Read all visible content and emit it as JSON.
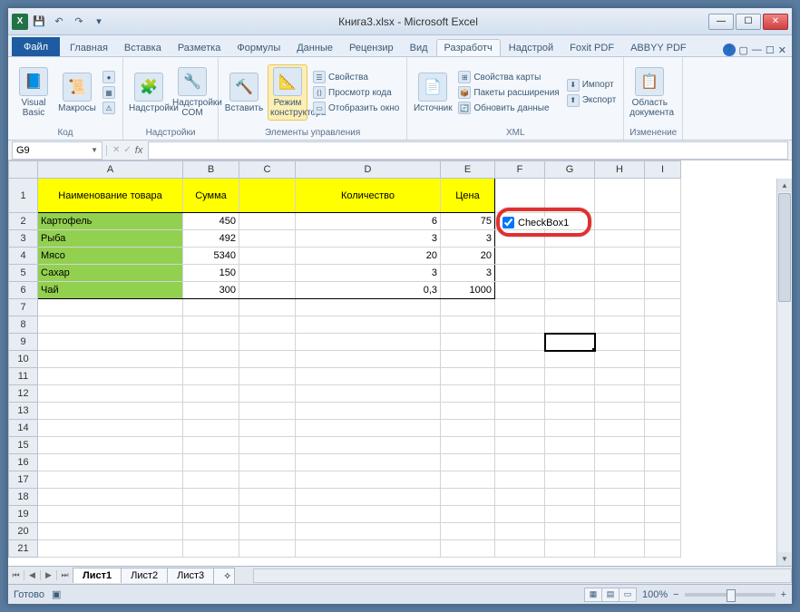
{
  "title": "Книга3.xlsx - Microsoft Excel",
  "qat": {
    "save": "💾",
    "undo": "↶",
    "redo": "↷"
  },
  "tabs": {
    "file": "Файл",
    "list": [
      "Главная",
      "Вставка",
      "Разметка",
      "Формулы",
      "Данные",
      "Рецензир",
      "Вид",
      "Разработч",
      "Надстрой",
      "Foxit PDF",
      "ABBYY PDF"
    ],
    "active": "Разработч"
  },
  "ribbon": {
    "code": {
      "vb": "Visual Basic",
      "macros": "Макросы",
      "label": "Код"
    },
    "addins": {
      "addins": "Надстройки",
      "com": "Надстройки COM",
      "label": "Надстройки"
    },
    "controls": {
      "insert": "Вставить",
      "design": "Режим конструктора",
      "props": "Свойства",
      "viewcode": "Просмотр кода",
      "dialog": "Отобразить окно",
      "label": "Элементы управления"
    },
    "xml": {
      "source": "Источник",
      "mapprops": "Свойства карты",
      "expansion": "Пакеты расширения",
      "refresh": "Обновить данные",
      "import": "Импорт",
      "export": "Экспорт",
      "label": "XML"
    },
    "modify": {
      "panel": "Область документа",
      "label": "Изменение"
    }
  },
  "namebox": "G9",
  "fx": "fx",
  "columns": [
    "A",
    "B",
    "C",
    "D",
    "E",
    "F",
    "G",
    "H",
    "I"
  ],
  "headers": {
    "name": "Наименование товара",
    "sum": "Сумма",
    "qty": "Количество",
    "price": "Цена"
  },
  "rows": [
    {
      "n": "1"
    },
    {
      "n": "2",
      "name": "Картофель",
      "sum": "450",
      "qty": "6",
      "price": "75"
    },
    {
      "n": "3",
      "name": "Рыба",
      "sum": "492",
      "qty": "3",
      "price": "3"
    },
    {
      "n": "4",
      "name": "Мясо",
      "sum": "5340",
      "qty": "20",
      "price": "20"
    },
    {
      "n": "5",
      "name": "Сахар",
      "sum": "150",
      "qty": "3",
      "price": "3"
    },
    {
      "n": "6",
      "name": "Чай",
      "sum": "300",
      "qty": "0,3",
      "price": "1000"
    }
  ],
  "checkbox_label": "CheckBox1",
  "sheets": {
    "list": [
      "Лист1",
      "Лист2",
      "Лист3"
    ],
    "active": "Лист1"
  },
  "status": {
    "ready": "Готово",
    "zoom": "100%"
  }
}
